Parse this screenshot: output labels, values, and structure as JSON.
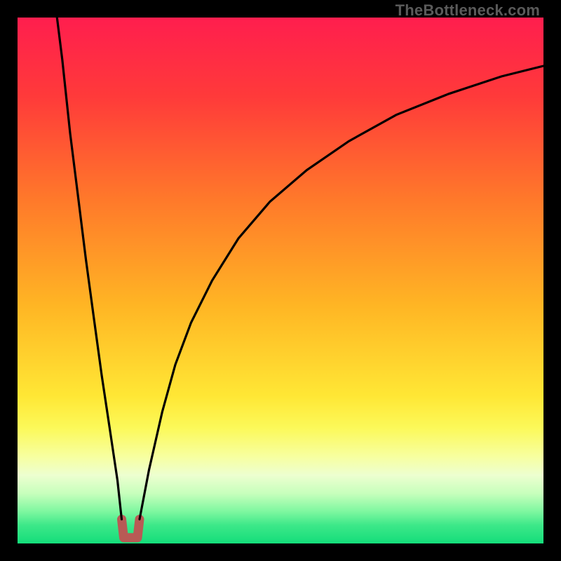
{
  "watermark": "TheBottleneck.com",
  "gradient_stops": [
    {
      "offset": 0.0,
      "color": "#ff1e4e"
    },
    {
      "offset": 0.15,
      "color": "#ff3a3a"
    },
    {
      "offset": 0.35,
      "color": "#ff7a2a"
    },
    {
      "offset": 0.55,
      "color": "#ffb624"
    },
    {
      "offset": 0.72,
      "color": "#ffe735"
    },
    {
      "offset": 0.78,
      "color": "#fcf959"
    },
    {
      "offset": 0.835,
      "color": "#f7ffa0"
    },
    {
      "offset": 0.87,
      "color": "#edffd0"
    },
    {
      "offset": 0.905,
      "color": "#c7ffbc"
    },
    {
      "offset": 0.94,
      "color": "#7cf79f"
    },
    {
      "offset": 0.965,
      "color": "#3de889"
    },
    {
      "offset": 1.0,
      "color": "#14dd7a"
    }
  ],
  "chart_data": {
    "type": "line",
    "title": "",
    "xlabel": "",
    "ylabel": "",
    "xlim": [
      0,
      100
    ],
    "ylim": [
      0,
      100
    ],
    "notch": {
      "x_center": 21.5,
      "x_left": 19.8,
      "x_right": 23.2,
      "y_top": 4.6,
      "y_bottom": 1.1,
      "color": "#b85a55"
    },
    "series": [
      {
        "name": "left-branch",
        "x": [
          7.5,
          8.5,
          10,
          11.5,
          13,
          14.5,
          16,
          17.5,
          19,
          19.8
        ],
        "y": [
          100,
          92,
          78,
          66,
          54,
          43,
          32,
          22,
          12,
          4.6
        ]
      },
      {
        "name": "right-branch",
        "x": [
          23.2,
          25,
          27.5,
          30,
          33,
          37,
          42,
          48,
          55,
          63,
          72,
          82,
          92,
          100
        ],
        "y": [
          4.6,
          14,
          25,
          34,
          42,
          50,
          58,
          65,
          71,
          76.5,
          81.5,
          85.5,
          88.8,
          90.8
        ]
      }
    ]
  }
}
